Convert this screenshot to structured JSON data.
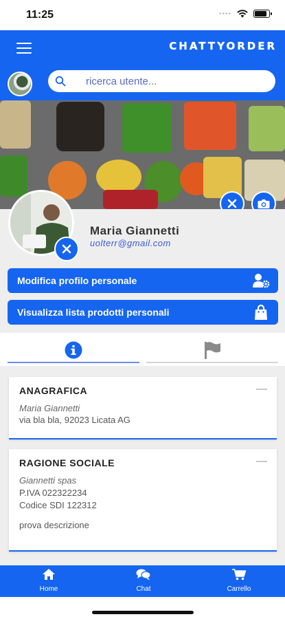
{
  "status_bar": {
    "time": "11:25"
  },
  "header": {
    "brand": "CHATTYORDER",
    "search": {
      "placeholder": "ricerca utente...",
      "value": ""
    }
  },
  "profile": {
    "name": "Maria Giannetti",
    "email": "uolterr@gmail.com"
  },
  "actions": {
    "edit_profile": "Modifica profilo personale",
    "view_products": "Visualizza lista prodotti personali"
  },
  "tabs": [
    {
      "icon": "info-icon",
      "active": true
    },
    {
      "icon": "flag-icon",
      "active": false
    }
  ],
  "cards": {
    "anagrafica": {
      "title": "ANAGRAFICA",
      "collapse": "—",
      "name": "Maria Giannetti",
      "address": "via bla bla, 92023 Licata AG"
    },
    "ragione_sociale": {
      "title": "RAGIONE SOCIALE",
      "collapse": "—",
      "company": "Giannetti spas",
      "piva": "P.IVA 022322234",
      "sdi": "Codice SDI 122312",
      "description": "prova descrizione"
    }
  },
  "bottom_nav": {
    "home": "Home",
    "chat": "Chat",
    "cart": "Carrello"
  },
  "colors": {
    "primary": "#1565f0",
    "background": "#eeeeee",
    "accent_text": "#3a5ad8"
  }
}
